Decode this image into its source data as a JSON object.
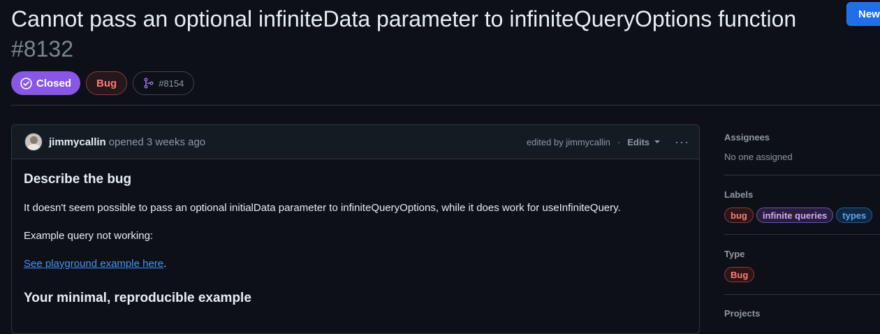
{
  "issue": {
    "title": "Cannot pass an optional infiniteData parameter to infiniteQueryOptions function",
    "number": "#8132",
    "state": "Closed",
    "type_label": "Bug",
    "linked_pr": "#8154"
  },
  "header": {
    "new_button": "New"
  },
  "comment": {
    "author": "jimmycallin",
    "opened_text": "opened 3 weeks ago",
    "edited_text": "edited by jimmycallin",
    "separator": "·",
    "edits_label": "Edits",
    "more_label": "···",
    "heading_bug": "Describe the bug",
    "paragraph1": "It doesn't seem possible to pass an optional initialData parameter to infiniteQueryOptions, while it does work for useInfiniteQuery.",
    "paragraph2": "Example query not working:",
    "link_text": "See playground example here",
    "link_suffix": ".",
    "heading_example": "Your minimal, reproducible example"
  },
  "sidebar": {
    "assignees_heading": "Assignees",
    "assignees_value": "No one assigned",
    "labels_heading": "Labels",
    "labels": [
      "bug",
      "infinite queries",
      "types"
    ],
    "type_heading": "Type",
    "type_value": "Bug",
    "projects_heading": "Projects"
  },
  "colors": {
    "closed": "#8957e5",
    "bug": "#ff7b72",
    "link": "#4493f8",
    "new_button": "#1f6feb"
  }
}
